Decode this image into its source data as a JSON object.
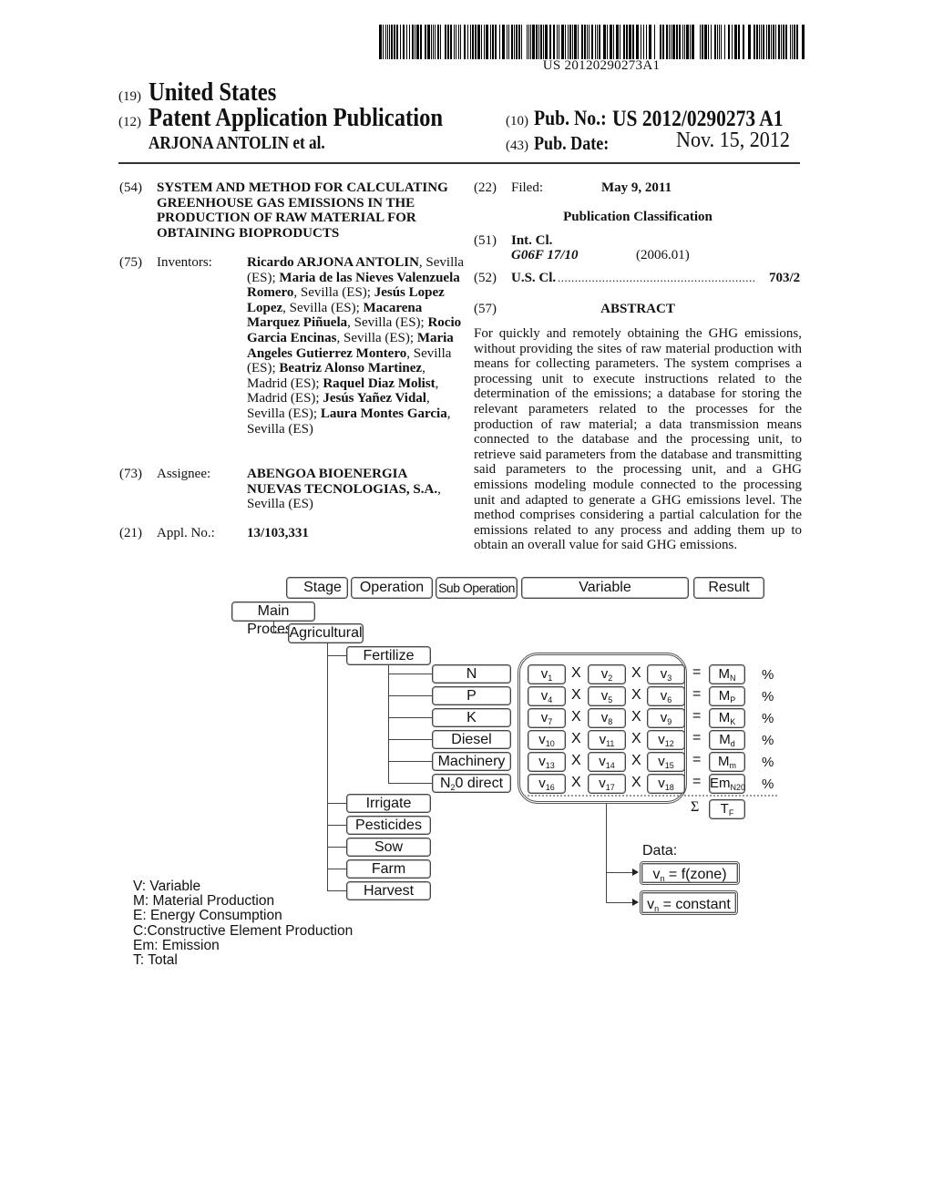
{
  "barcode": {
    "text": "US 20120290273A1"
  },
  "header": {
    "country_code": "(19)",
    "country": "United States",
    "type_code": "(12)",
    "type": "Patent Application Publication",
    "authors": "ARJONA ANTOLIN et al.",
    "pub_no_code": "(10)",
    "pub_no_label": "Pub. No.:",
    "pub_no": "US 2012/0290273 A1",
    "pub_date_code": "(43)",
    "pub_date_label": "Pub. Date:",
    "pub_date": "Nov. 15, 2012"
  },
  "left": {
    "title_code": "(54)",
    "title": "SYSTEM AND METHOD FOR CALCULATING GREENHOUSE GAS EMISSIONS IN THE PRODUCTION OF RAW MATERIAL FOR OBTAINING BIOPRODUCTS",
    "inventors_code": "(75)",
    "inventors_label": "Inventors:",
    "inventors": [
      {
        "name": "Ricardo ARJONA ANTOLIN",
        "place": "Sevilla (ES)"
      },
      {
        "name": "Maria de las Nieves Valenzuela Romero",
        "place": "Sevilla (ES)"
      },
      {
        "name": "Jesús Lopez Lopez",
        "place": "Sevilla (ES)"
      },
      {
        "name": "Macarena Marquez Piñuela",
        "place": "Sevilla (ES)"
      },
      {
        "name": "Rocio Garcia Encinas",
        "place": "Sevilla (ES)"
      },
      {
        "name": "Maria Angeles Gutierrez Montero",
        "place": "Sevilla (ES)"
      },
      {
        "name": "Beatriz Alonso Martinez",
        "place": "Madrid (ES)"
      },
      {
        "name": "Raquel Diaz Molist",
        "place": "Madrid (ES)"
      },
      {
        "name": "Jesús Yañez Vidal",
        "place": "Sevilla (ES)"
      },
      {
        "name": "Laura Montes Garcia",
        "place": "Sevilla (ES)"
      }
    ],
    "assignee_code": "(73)",
    "assignee_label": "Assignee:",
    "assignee_line1": "ABENGOA BIOENERGIA",
    "assignee_line2": "NUEVAS TECNOLOGIAS, S.A.",
    "assignee_place": "Sevilla (ES)",
    "appl_code": "(21)",
    "appl_label": "Appl. No.:",
    "appl_no": "13/103,331"
  },
  "right": {
    "filed_code": "(22)",
    "filed_label": "Filed:",
    "filed_date": "May 9, 2011",
    "pub_class_heading": "Publication Classification",
    "int_cl_code": "(51)",
    "int_cl_label": "Int. Cl.",
    "int_cl_value": "G06F 17/10",
    "int_cl_year": "(2006.01)",
    "us_cl_code": "(52)",
    "us_cl_label": "U.S. Cl.",
    "us_cl_dots": "..........................................................",
    "us_cl_value": "703/2",
    "abstract_code": "(57)",
    "abstract_heading": "ABSTRACT",
    "abstract": "For quickly and remotely obtaining the GHG emissions, without providing the sites of raw material production with means for collecting parameters. The system comprises a processing unit to execute instructions related to the determination of the emissions; a database for storing the relevant parameters related to the processes for the production of raw material; a data transmission means connected to the database and the processing unit, to retrieve said parameters from the database and transmitting said parameters to the processing unit, and a GHG emissions modeling module connected to the processing unit and adapted to generate a GHG emissions level. The method comprises considering a partial calculation for the emissions related to any process and adding them up to obtain an overall value for said GHG emissions."
  },
  "diagram": {
    "headers": [
      "Stage",
      "Operation",
      "Sub Operation",
      "Variable",
      "Result"
    ],
    "main_process": "Main Process",
    "stage": "Agricultural",
    "operations": [
      "Fertilize",
      "Irrigate",
      "Pesticides",
      "Sow",
      "Farm",
      "Harvest"
    ],
    "sub_operations": [
      {
        "label": "N",
        "vars": [
          "v",
          "1",
          "v",
          "2",
          "v",
          "3"
        ],
        "result": "M",
        "result_sub": "N"
      },
      {
        "label": "P",
        "vars": [
          "v",
          "4",
          "v",
          "5",
          "v",
          "6"
        ],
        "result": "M",
        "result_sub": "P"
      },
      {
        "label": "K",
        "vars": [
          "v",
          "7",
          "v",
          "8",
          "v",
          "9"
        ],
        "result": "M",
        "result_sub": "K"
      },
      {
        "label": "Diesel",
        "vars": [
          "v",
          "10",
          "v",
          "11",
          "v",
          "12"
        ],
        "result": "M",
        "result_sub": "d"
      },
      {
        "label": "Machinery",
        "vars": [
          "v",
          "13",
          "v",
          "14",
          "v",
          "15"
        ],
        "result": "M",
        "result_sub": "m"
      },
      {
        "label": "N20 direct",
        "label_main": "N",
        "label_sub": "2",
        "label_rest": "0 direct",
        "vars": [
          "v",
          "16",
          "v",
          "17",
          "v",
          "18"
        ],
        "result": "Em",
        "result_sub": "N20"
      }
    ],
    "times": "X",
    "equals": "=",
    "percent": "%",
    "sigma": "Σ",
    "total": "T",
    "total_sub": "F",
    "data_label": "Data:",
    "data_zone": {
      "v": "v",
      "sub": "n",
      "rest": " = f(zone)"
    },
    "data_const": {
      "v": "v",
      "sub": "n",
      "rest": " = constant"
    },
    "legend": [
      "V: Variable",
      "M: Material Production",
      "E: Energy Consumption",
      "C:Constructive Element Production",
      "Em: Emission",
      "T: Total"
    ]
  }
}
